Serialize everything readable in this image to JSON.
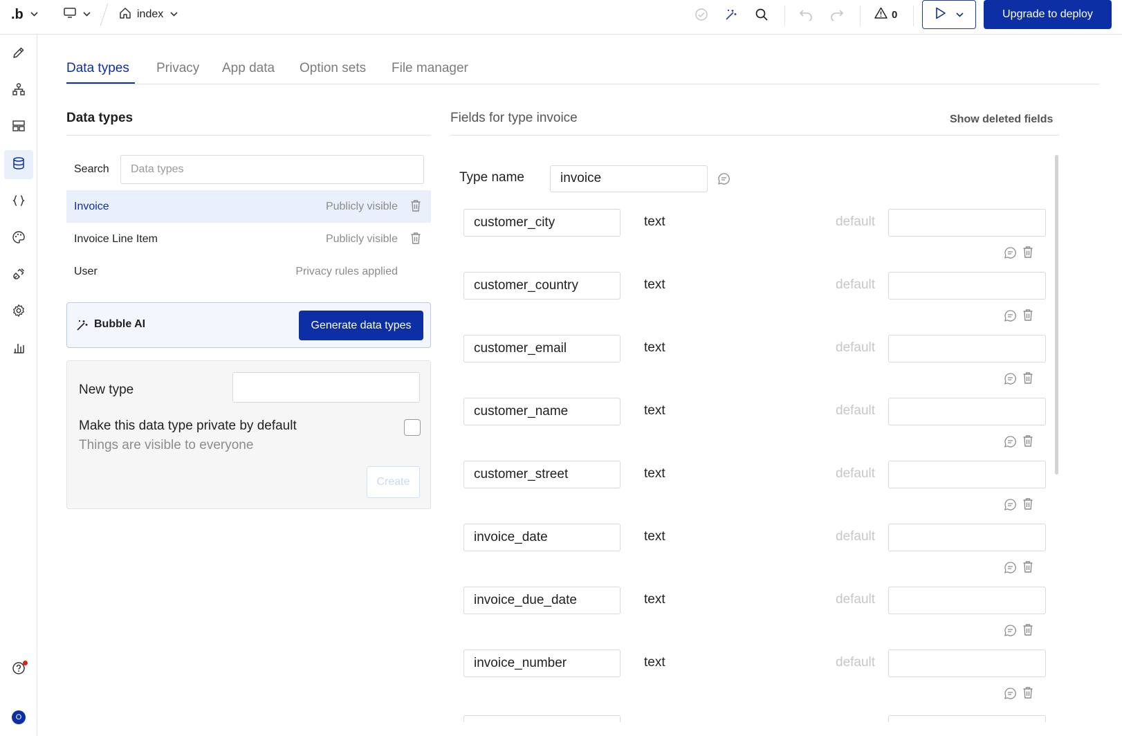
{
  "topbar": {
    "logo": ".b",
    "page_name": "index",
    "issues_count": "0",
    "deploy_label": "Upgrade to deploy"
  },
  "rail": {
    "items": [
      "design-icon",
      "workflow-icon",
      "elements-icon",
      "data-icon",
      "styles-code-icon",
      "styles-icon",
      "plugins-icon",
      "settings-icon",
      "logs-icon"
    ],
    "active": "data-icon",
    "help_icon": "help-icon",
    "avatar_initial": "O"
  },
  "tabs": [
    "Data types",
    "Privacy",
    "App data",
    "Option sets",
    "File manager"
  ],
  "active_tab": "Data types",
  "left_panel": {
    "title": "Data types",
    "search_label": "Search",
    "search_placeholder": "Data types",
    "types": [
      {
        "name": "Invoice",
        "visibility": "Publicly visible",
        "deletable": true,
        "selected": true
      },
      {
        "name": "Invoice Line Item",
        "visibility": "Publicly visible",
        "deletable": true,
        "selected": false
      },
      {
        "name": "User",
        "visibility": "Privacy rules applied",
        "deletable": false,
        "selected": false
      }
    ],
    "ai": {
      "label": "Bubble AI",
      "button": "Generate data types"
    },
    "new_type": {
      "label": "New type",
      "private_label": "Make this data type private by default",
      "private_sub": "Things are visible to everyone",
      "create_button": "Create"
    }
  },
  "right_panel": {
    "title": "Fields for type invoice",
    "show_deleted": "Show deleted fields",
    "type_name_label": "Type name",
    "type_name_value": "invoice",
    "default_label": "default",
    "fields": [
      {
        "name": "customer_city",
        "type": "text"
      },
      {
        "name": "customer_country",
        "type": "text"
      },
      {
        "name": "customer_email",
        "type": "text"
      },
      {
        "name": "customer_name",
        "type": "text"
      },
      {
        "name": "customer_street",
        "type": "text"
      },
      {
        "name": "invoice_date",
        "type": "text"
      },
      {
        "name": "invoice_due_date",
        "type": "text"
      },
      {
        "name": "invoice_number",
        "type": "text"
      }
    ]
  },
  "colors": {
    "accent": "#0c2fa5",
    "selected_bg": "#e9effb",
    "muted_text": "#8c8c8c"
  }
}
